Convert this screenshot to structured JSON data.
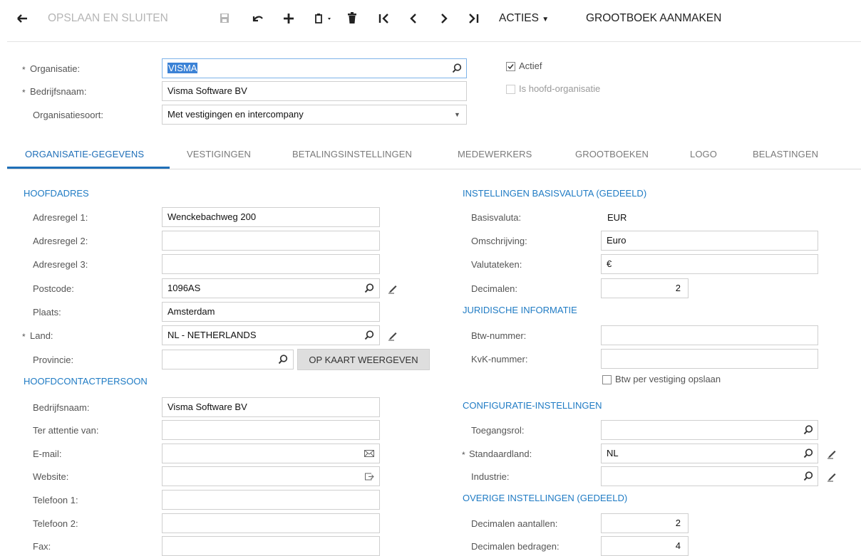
{
  "toolbar": {
    "save_close_label": "OPSLAAN EN SLUITEN",
    "actions_label": "ACTIES",
    "create_ledger_label": "GROOTBOEK AANMAKEN"
  },
  "header": {
    "organisation_label": "Organisatie:",
    "organisation_value": "VISMA",
    "company_name_label": "Bedrijfsnaam:",
    "company_name_value": "Visma Software BV",
    "org_type_label": "Organisatiesoort:",
    "org_type_value": "Met vestigingen en intercompany",
    "active_label": "Actief",
    "active_checked": true,
    "is_main_org_label": "Is hoofd-organisatie",
    "is_main_org_checked": false
  },
  "tabs": [
    {
      "label": "ORGANISATIE-GEGEVENS",
      "active": true
    },
    {
      "label": "VESTIGINGEN",
      "active": false
    },
    {
      "label": "BETALINGSINSTELLINGEN",
      "active": false
    },
    {
      "label": "MEDEWERKERS",
      "active": false
    },
    {
      "label": "GROOTBOEKEN",
      "active": false
    },
    {
      "label": "LOGO",
      "active": false
    },
    {
      "label": "BELASTINGEN",
      "active": false
    }
  ],
  "main_address": {
    "section_title": "HOOFDADRES",
    "address1_label": "Adresregel 1:",
    "address1_value": "Wenckebachweg 200",
    "address2_label": "Adresregel 2:",
    "address2_value": "",
    "address3_label": "Adresregel 3:",
    "address3_value": "",
    "postcode_label": "Postcode:",
    "postcode_value": "1096AS",
    "city_label": "Plaats:",
    "city_value": "Amsterdam",
    "country_label": "Land:",
    "country_value": "NL - NETHERLANDS",
    "province_label": "Provincie:",
    "province_value": "",
    "map_button_label": "OP KAART WEERGEVEN"
  },
  "main_contact": {
    "section_title": "HOOFDCONTACTPERSOON",
    "company_label": "Bedrijfsnaam:",
    "company_value": "Visma Software BV",
    "attention_label": "Ter attentie van:",
    "attention_value": "",
    "email_label": "E-mail:",
    "email_value": "",
    "website_label": "Website:",
    "website_value": "",
    "phone1_label": "Telefoon 1:",
    "phone1_value": "",
    "phone2_label": "Telefoon 2:",
    "phone2_value": "",
    "fax_label": "Fax:",
    "fax_value": ""
  },
  "base_currency": {
    "section_title": "INSTELLINGEN BASISVALUTA (GEDEELD)",
    "currency_label": "Basisvaluta:",
    "currency_value": "EUR",
    "description_label": "Omschrijving:",
    "description_value": "Euro",
    "symbol_label": "Valutateken:",
    "symbol_value": "€",
    "decimals_label": "Decimalen:",
    "decimals_value": "2"
  },
  "legal": {
    "section_title": "JURIDISCHE INFORMATIE",
    "vat_label": "Btw-nummer:",
    "vat_value": "",
    "coc_label": "KvK-nummer:",
    "coc_value": "",
    "vat_per_branch_label": "Btw per vestiging opslaan",
    "vat_per_branch_checked": false
  },
  "config": {
    "section_title": "CONFIGURATIE-INSTELLINGEN",
    "access_role_label": "Toegangsrol:",
    "access_role_value": "",
    "default_country_label": "Standaardland:",
    "default_country_value": "NL",
    "industry_label": "Industrie:",
    "industry_value": ""
  },
  "other": {
    "section_title": "OVERIGE INSTELLINGEN (GEDEELD)",
    "qty_decimals_label": "Decimalen aantallen:",
    "qty_decimals_value": "2",
    "amount_decimals_label": "Decimalen bedragen:",
    "amount_decimals_value": "4"
  },
  "icons": {
    "back": "back-arrow-icon",
    "save": "floppy-disk-icon",
    "undo": "undo-icon",
    "add": "plus-icon",
    "copy_paste": "clipboard-icon",
    "delete": "trash-icon",
    "first": "first-record-icon",
    "prev": "previous-record-icon",
    "next": "next-record-icon",
    "last": "last-record-icon",
    "search": "search-icon",
    "edit": "pencil-icon",
    "mail": "envelope-icon",
    "open_link": "open-link-icon",
    "dropdown": "caret-down-icon"
  },
  "colors": {
    "accent": "#1f7bc4",
    "selection": "#3b82d6"
  }
}
